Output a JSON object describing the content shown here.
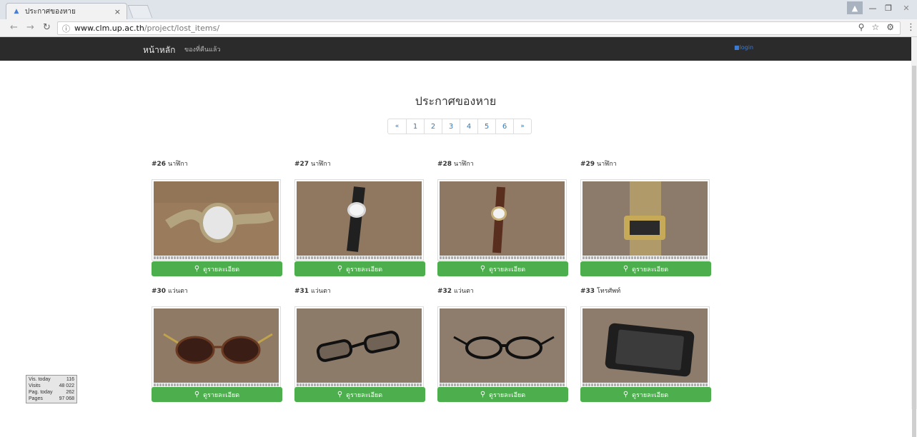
{
  "browser": {
    "tab_title": "ประกาศของหาย",
    "tab_close": "×",
    "url_host": "www.clm.up.ac.th",
    "url_path": "/project/lost_items/"
  },
  "navbar": {
    "home": "หน้าหลัก",
    "returned": "ของที่คืนแล้ว",
    "login": "login"
  },
  "page_title": "ประกาศของหาย",
  "pagination": [
    "«",
    "1",
    "2",
    "3",
    "4",
    "5",
    "6",
    "»"
  ],
  "detail_label": "ดูรายละเอียด",
  "items": [
    {
      "num": "#26",
      "name": "นาฬิกา",
      "image": "beige-watch"
    },
    {
      "num": "#27",
      "name": "นาฬิกา",
      "image": "black-leather-watch"
    },
    {
      "num": "#28",
      "name": "นาฬิกา",
      "image": "brown-leather-watch"
    },
    {
      "num": "#29",
      "name": "นาฬิกา",
      "image": "gold-digital-watch"
    },
    {
      "num": "#30",
      "name": "แว่นตา",
      "image": "tortoise-sunglasses"
    },
    {
      "num": "#31",
      "name": "แว่นตา",
      "image": "black-glasses"
    },
    {
      "num": "#32",
      "name": "แว่นตา",
      "image": "black-glasses-2"
    },
    {
      "num": "#33",
      "name": "โทรศัพท์",
      "image": "black-phone"
    }
  ],
  "counter": {
    "rows": [
      {
        "label": "Vis. today",
        "value": "116"
      },
      {
        "label": "Visits",
        "value": "48 022"
      },
      {
        "label": "Pag. today",
        "value": "262"
      },
      {
        "label": "Pages",
        "value": "97 068"
      }
    ]
  }
}
